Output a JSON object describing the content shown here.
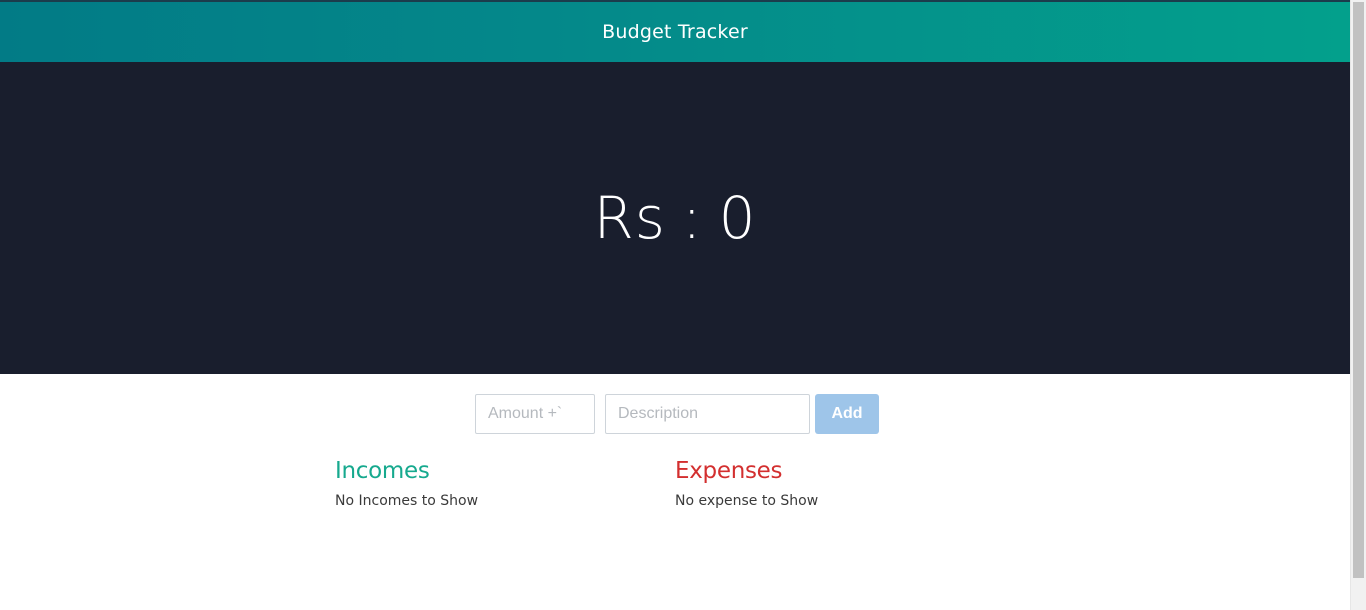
{
  "header": {
    "title": "Budget Tracker"
  },
  "balance": {
    "currency": "Rs",
    "separator": ":",
    "amount": "0"
  },
  "form": {
    "amount_placeholder": "Amount +`",
    "description_placeholder": "Description",
    "add_label": "Add"
  },
  "incomes": {
    "title": "Incomes",
    "empty_text": "No Incomes to Show"
  },
  "expenses": {
    "title": "Expenses",
    "empty_text": "No expense to Show"
  },
  "colors": {
    "header_start": "#027b86",
    "header_end": "#03a08c",
    "hero_background": "#191e2d",
    "incomes": "#16a98e",
    "expenses": "#d32f2f",
    "add_button": "#9ec5e9"
  }
}
